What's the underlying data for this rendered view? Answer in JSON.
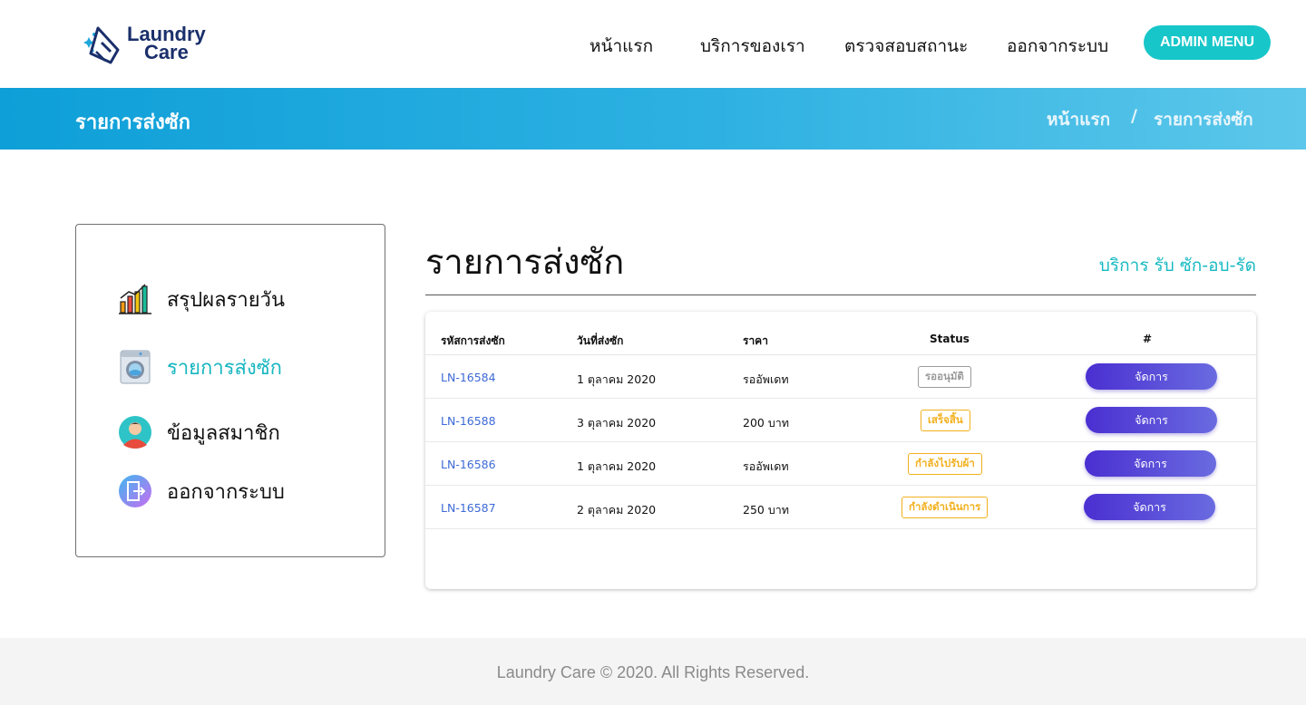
{
  "brand": {
    "name_line1": "Laundry",
    "name_line2": "Care",
    "color": "#1a2f6b"
  },
  "nav": {
    "items": [
      {
        "label": "หน้าแรก"
      },
      {
        "label": "บริการของเรา"
      },
      {
        "label": "ตรวจสอบสถานะ"
      },
      {
        "label": "ออกจากระบบ"
      }
    ],
    "admin_button": "ADMIN MENU",
    "admin_color": "#17c6c9"
  },
  "banner": {
    "title": "รายการส่งซัก",
    "breadcrumb": {
      "home": "หน้าแรก",
      "separator": "/",
      "current": "รายการส่งซัก"
    }
  },
  "sidebar": {
    "items": [
      {
        "label": "สรุปผลรายวัน",
        "icon": "chart-bars-icon",
        "active": false
      },
      {
        "label": "รายการส่งซัก",
        "icon": "washing-machine-icon",
        "active": true
      },
      {
        "label": "ข้อมูลสมาชิก",
        "icon": "user-avatar-icon",
        "active": false
      },
      {
        "label": "ออกจากระบบ",
        "icon": "logout-door-icon",
        "active": false
      }
    ]
  },
  "main": {
    "title": "รายการส่งซัก",
    "subtitle": "บริการ รับ ซัก-อบ-รัด",
    "table": {
      "headers": [
        "รหัสการส่งซัก",
        "วันที่ส่งซัก",
        "ราคา",
        "Status",
        "#"
      ],
      "rows": [
        {
          "code": "LN-16584",
          "date": "1 ตุลาคม 2020",
          "price": "รออัพเดท",
          "status": "รออนุมัติ",
          "status_color": "#9a9a9a",
          "action": "จัดการ"
        },
        {
          "code": "LN-16588",
          "date": "3 ตุลาคม 2020",
          "price": "200 บาท",
          "status": "เสร็จสิ้น",
          "status_color": "#f2b01e",
          "action": "จัดการ"
        },
        {
          "code": "LN-16586",
          "date": "1 ตุลาคม 2020",
          "price": "รออัพเดท",
          "status": "กำลังไปรับผ้า",
          "status_color": "#f2b01e",
          "action": "จัดการ"
        },
        {
          "code": "LN-16587",
          "date": "2 ตุลาคม 2020",
          "price": "250 บาท",
          "status": "กำลังดำเนินการ",
          "status_color": "#f2b01e",
          "action": "จัดการ"
        }
      ]
    }
  },
  "footer": {
    "text": "Laundry Care © 2020. All Rights Reserved."
  }
}
